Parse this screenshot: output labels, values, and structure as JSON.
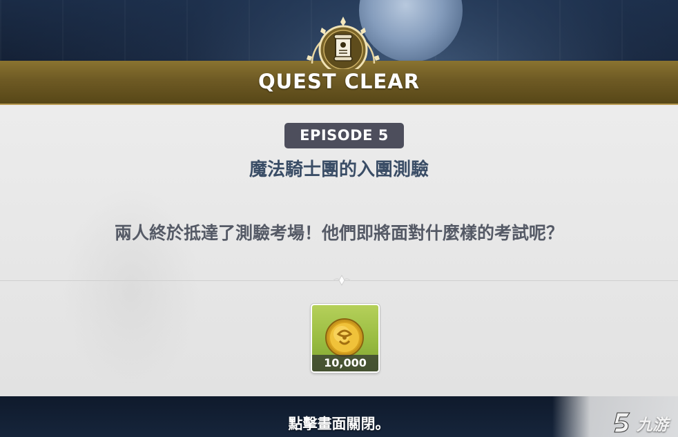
{
  "banner": {
    "title": "QUEST CLEAR"
  },
  "episode": {
    "badge": "EPISODE 5",
    "title": "魔法騎士團的入團測驗",
    "description": "兩人終於抵達了測驗考場！他們即將面對什麼樣的考試呢？"
  },
  "reward": {
    "icon": "gold-coin-icon",
    "amount": "10,000"
  },
  "footer": {
    "close_hint": "點擊畫面關閉。"
  },
  "watermark": {
    "text": "九游"
  },
  "colors": {
    "banner": "#6e5a24",
    "badge": "#4d4e5c",
    "title_text": "#3a4d66",
    "reward_bg": "#98bb40"
  }
}
